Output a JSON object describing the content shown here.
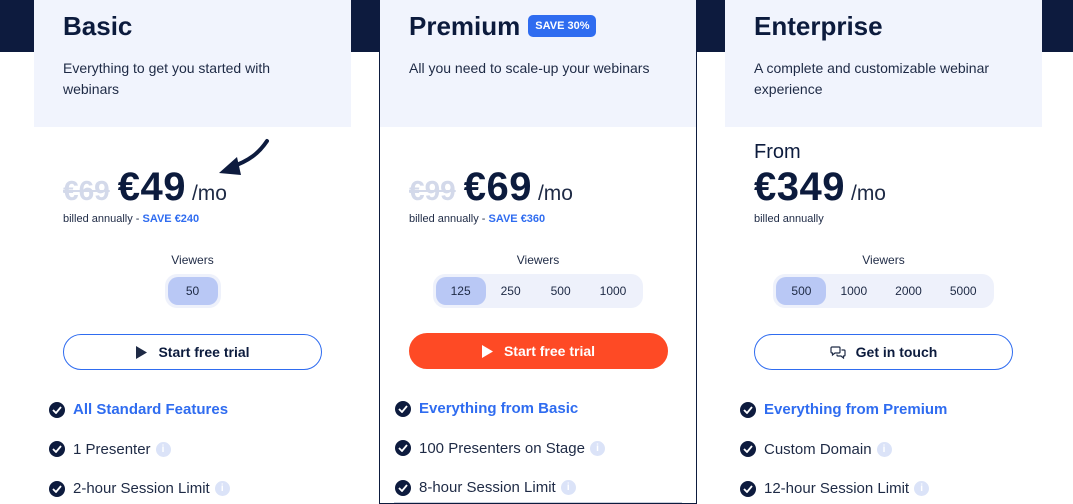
{
  "plans": {
    "basic": {
      "name": "Basic",
      "description": "Everything to get you started with webinars",
      "old_price": "€69",
      "price": "€49",
      "per": "/mo",
      "billing": "billed annually - ",
      "save": "SAVE €240",
      "viewers_label": "Viewers",
      "viewers": [
        "50"
      ],
      "cta": "Start free trial",
      "features": [
        "All Standard Features",
        "1 Presenter",
        "2-hour Session Limit"
      ]
    },
    "premium": {
      "name": "Premium",
      "badge": "SAVE 30%",
      "description": "All you need to scale-up your webinars",
      "old_price": "€99",
      "price": "€69",
      "per": "/mo",
      "billing": "billed annually - ",
      "save": "SAVE €360",
      "viewers_label": "Viewers",
      "viewers": [
        "125",
        "250",
        "500",
        "1000"
      ],
      "cta": "Start free trial",
      "features": [
        "Everything from Basic",
        "100 Presenters on Stage",
        "8-hour Session Limit"
      ]
    },
    "enterprise": {
      "name": "Enterprise",
      "description": "A complete and customizable webinar experience",
      "from": "From",
      "price": "€349",
      "per": "/mo",
      "billing": "billed annually",
      "viewers_label": "Viewers",
      "viewers": [
        "500",
        "1000",
        "2000",
        "5000"
      ],
      "cta": "Get in touch",
      "features": [
        "Everything from Premium",
        "Custom Domain",
        "12-hour Session Limit"
      ]
    }
  },
  "info_glyph": "i",
  "colors": {
    "navy": "#0d1b3e",
    "accent_blue": "#2f6cf0",
    "cta_orange": "#fe4a25",
    "selected_viewer": "#b9c8f5",
    "card_header_bg": "#f1f4fd"
  }
}
